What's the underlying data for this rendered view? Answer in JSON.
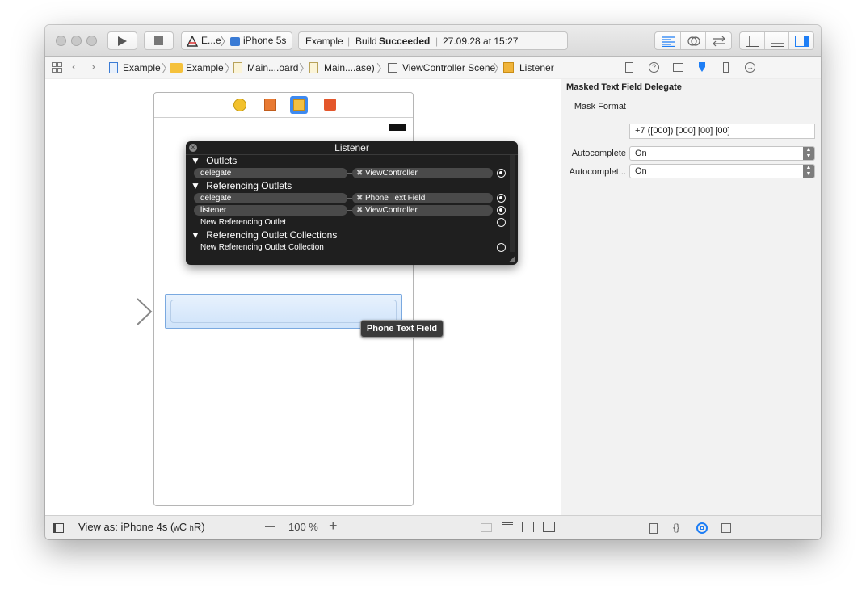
{
  "toolbar": {
    "scheme_target": "E...e",
    "scheme_device": "iPhone 5s",
    "status_project": "Example",
    "status_build_prefix": "Build",
    "status_build_result": "Succeeded",
    "status_time": "27.09.28 at 15:27"
  },
  "jumpbar": {
    "crumbs": [
      "Example",
      "Example",
      "Main....oard",
      "Main....ase)",
      "ViewController Scene",
      "Listener"
    ]
  },
  "popover": {
    "title": "Listener",
    "sections": {
      "outlets": "Outlets",
      "referencing_outlets": "Referencing Outlets",
      "referencing_collections": "Referencing Outlet Collections"
    },
    "outlets": [
      {
        "name": "delegate",
        "target": "ViewController"
      }
    ],
    "referencing": [
      {
        "name": "delegate",
        "target": "Phone Text Field"
      },
      {
        "name": "listener",
        "target": "ViewController"
      }
    ],
    "new_referencing_outlet": "New Referencing Outlet",
    "new_referencing_collection": "New Referencing Outlet Collection"
  },
  "canvas": {
    "tooltip": "Phone Text Field"
  },
  "bottombar": {
    "view_as_prefix": "View as: iPhone 4s (",
    "size_w": "w",
    "size_wc": "C",
    "size_h": "h",
    "size_hr": "R",
    "view_as_suffix": ")",
    "zoom_minus": "—",
    "zoom": "100 %",
    "zoom_plus": "+"
  },
  "inspector": {
    "section_title": "Masked Text Field Delegate",
    "mask_format_label": "Mask Format",
    "mask_format_value": "+7 ([000]) [000] [00] [00]",
    "autocomplete_label": "Autocomplete",
    "autocomplete_value": "On",
    "autocomplete2_label": "Autocomplet...",
    "autocomplete2_value": "On"
  },
  "colors": {
    "accent_blue": "#1e7ef5",
    "popover_bg": "#1f1f1f",
    "textfield_fill": "#dbeafb"
  }
}
